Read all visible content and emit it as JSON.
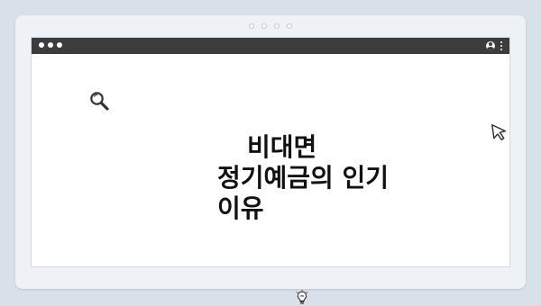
{
  "window": {
    "dots": [
      "dot",
      "dot",
      "dot"
    ]
  },
  "browser": {
    "controls": [
      "close",
      "minimize",
      "maximize"
    ]
  },
  "content": {
    "headline": {
      "line1": "비대면",
      "line2": "정기예금의 인기",
      "line3": "이유"
    }
  },
  "icons": {
    "search": "search-icon",
    "cursor": "cursor-icon",
    "bulb": "lightbulb-icon",
    "profile": "profile-icon",
    "menu": "more-vertical-icon"
  },
  "colors": {
    "background": "#d8e0ea",
    "frame": "#eef2f7",
    "titlebar": "#3c3c3c",
    "text": "#111111"
  }
}
